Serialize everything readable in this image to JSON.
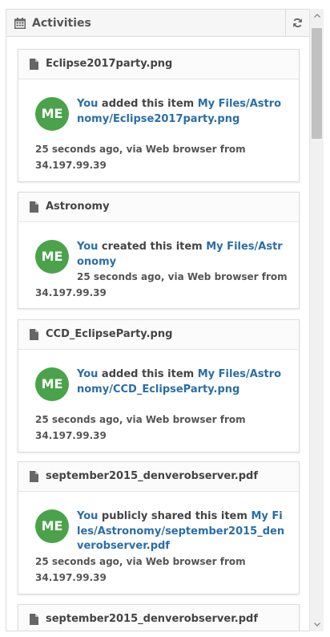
{
  "panel": {
    "title": "Activities",
    "calendar_icon": "calendar-icon",
    "refresh_icon": "refresh-icon"
  },
  "colors": {
    "accent_link": "#2a6ea6",
    "avatar_bg": "#4aa34a",
    "text": "#444444"
  },
  "activities": [
    {
      "file": "Eclipse2017party.png",
      "avatar": "ME",
      "actor": "You",
      "action": " added this item ",
      "path": "My Files/Astronomy/Eclipse2017party.png",
      "meta_line1": "25 seconds ago, via Web browser from",
      "meta_line2": "34.197.99.39"
    },
    {
      "file": "Astronomy",
      "avatar": "ME",
      "actor": "You",
      "action": " created this item ",
      "path": "My Files/Astronomy",
      "meta_line1": "25 seconds ago, via Web browser from",
      "meta_line2": "34.197.99.39"
    },
    {
      "file": "CCD_EclipseParty.png",
      "avatar": "ME",
      "actor": "You",
      "action": " added this item ",
      "path": "My Files/Astronomy/CCD_EclipseParty.png",
      "meta_line1": "25 seconds ago, via Web browser from",
      "meta_line2": "34.197.99.39"
    },
    {
      "file": "september2015_denverobserver.pdf",
      "avatar": "ME",
      "actor": "You",
      "action": " publicly shared this item ",
      "path": "My Files/Astronomy/september2015_denverobserver.pdf",
      "meta_line1": "25 seconds ago, via Web browser from",
      "meta_line2": "34.197.99.39"
    },
    {
      "file": "september2015_denverobserver.pdf"
    }
  ]
}
